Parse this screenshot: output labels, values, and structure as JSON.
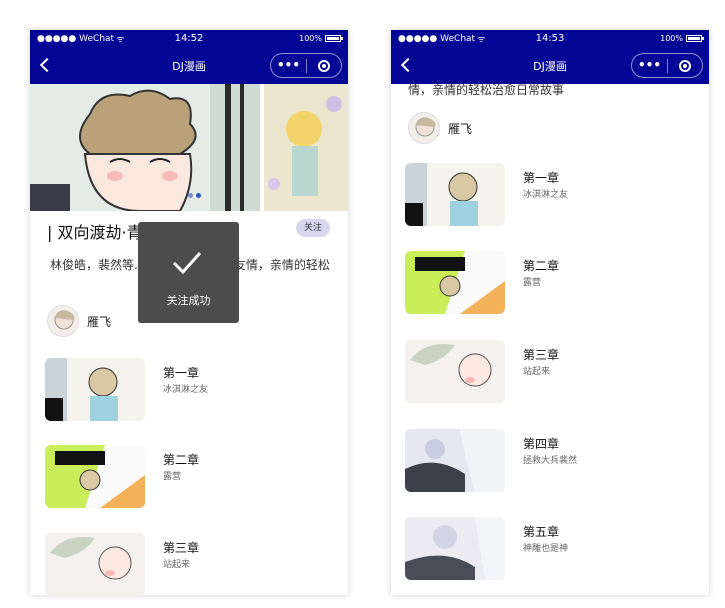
{
  "status_bar": {
    "carrier": "●●●●● WeChat",
    "battery": "100%"
  },
  "left": {
    "time": "14:52",
    "nav_title": "DJ漫画",
    "comic_title": "| 双向渡劫·青",
    "follow_label": "关注",
    "description": "林俊皓，裴然等…… 于青涩暧昧，友情，亲情的轻松",
    "author": "雁飞",
    "toast_text": "关注成功",
    "chapters": [
      {
        "title": "第一章",
        "subtitle": "冰淇淋之友"
      },
      {
        "title": "第二章",
        "subtitle": "露营"
      },
      {
        "title": "第三章",
        "subtitle": "站起来"
      }
    ]
  },
  "right": {
    "time": "14:53",
    "nav_title": "DJ漫画",
    "description_tail": "情，亲情的轻松治愈日常故事",
    "author": "雁飞",
    "chapters": [
      {
        "title": "第一章",
        "subtitle": "冰淇淋之友"
      },
      {
        "title": "第二章",
        "subtitle": "露营"
      },
      {
        "title": "第三章",
        "subtitle": "站起来"
      },
      {
        "title": "第四章",
        "subtitle": "拯救大兵裴然"
      },
      {
        "title": "第五章",
        "subtitle": "神雕也是神"
      }
    ]
  },
  "colors": {
    "nav": "#040796",
    "toast": "#4c4c4c",
    "follow_bg": "#d9d7ef"
  }
}
